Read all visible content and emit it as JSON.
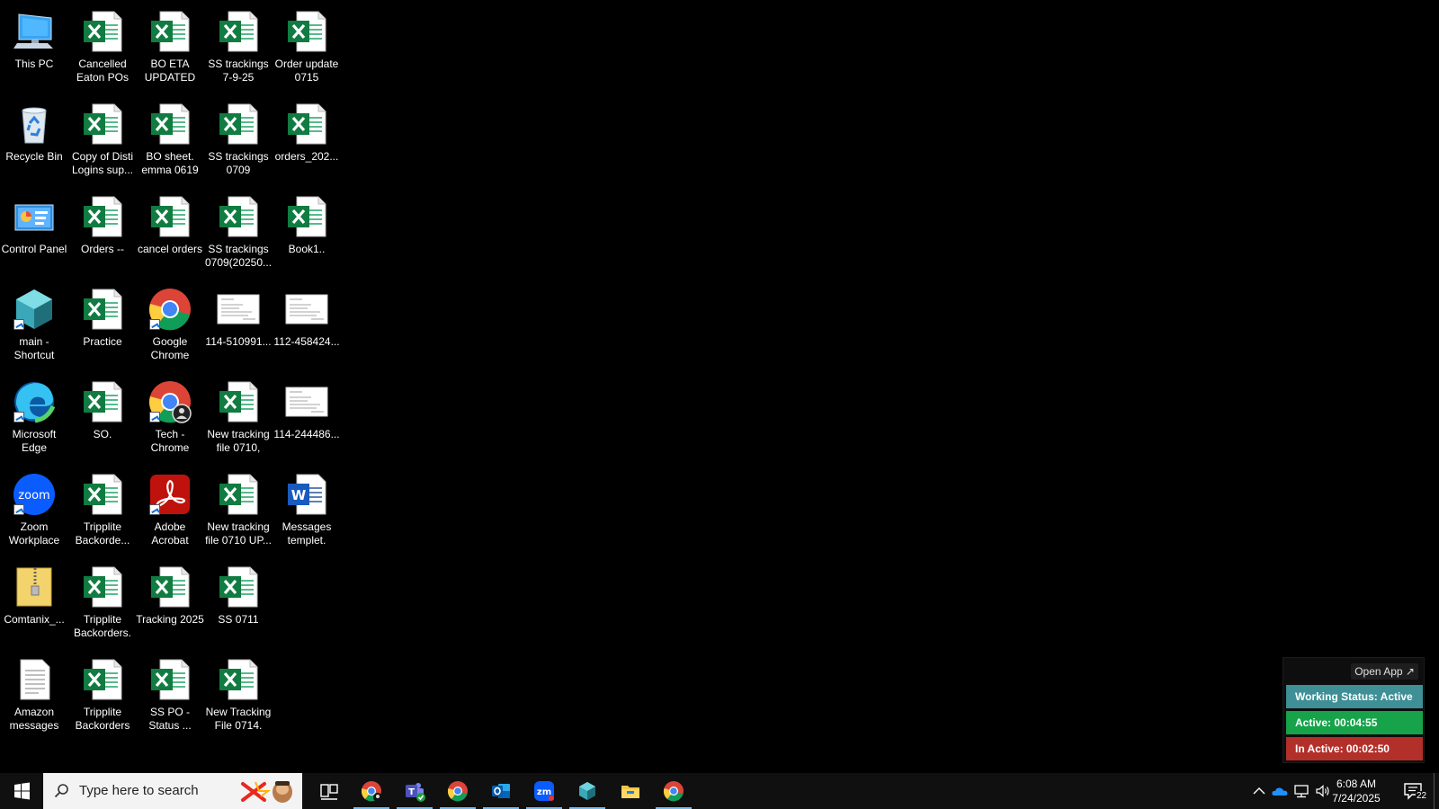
{
  "desktop": {
    "icons": [
      {
        "label": "This PC",
        "type": "pc"
      },
      {
        "label": "Recycle Bin",
        "type": "bin"
      },
      {
        "label": "Control Panel",
        "type": "cpanel"
      },
      {
        "label": "main - Shortcut",
        "type": "main"
      },
      {
        "label": "Microsoft Edge",
        "type": "edge"
      },
      {
        "label": "Zoom Workplace",
        "type": "zoom"
      },
      {
        "label": "Comtanix_...",
        "type": "zip"
      },
      {
        "label": "Amazon messages",
        "type": "txt"
      },
      {
        "label": "Cancelled Eaton POs",
        "type": "excel"
      },
      {
        "label": "Copy of Disti Logins sup...",
        "type": "excel"
      },
      {
        "label": "Orders --",
        "type": "excel"
      },
      {
        "label": "Practice",
        "type": "excel"
      },
      {
        "label": "SO.",
        "type": "excel"
      },
      {
        "label": "Tripplite Backorde...",
        "type": "excel"
      },
      {
        "label": "Tripplite Backorders.",
        "type": "excel"
      },
      {
        "label": "Tripplite Backorders",
        "type": "excel"
      },
      {
        "label": "BO ETA UPDATED",
        "type": "excel"
      },
      {
        "label": "BO sheet. emma 0619",
        "type": "excel"
      },
      {
        "label": "cancel orders",
        "type": "excel"
      },
      {
        "label": "Google Chrome",
        "type": "chrome"
      },
      {
        "label": "Tech - Chrome",
        "type": "chrome-profile"
      },
      {
        "label": "Adobe Acrobat",
        "type": "acrobat"
      },
      {
        "label": "Tracking 2025",
        "type": "excel"
      },
      {
        "label": "SS PO - Status ...",
        "type": "excel"
      },
      {
        "label": "SS trackings 7-9-25",
        "type": "excel"
      },
      {
        "label": "SS trackings 0709",
        "type": "excel"
      },
      {
        "label": "SS trackings 0709(20250...",
        "type": "excel"
      },
      {
        "label": "114-510991...",
        "type": "image"
      },
      {
        "label": "New tracking file 0710,",
        "type": "excel"
      },
      {
        "label": "New tracking file 0710 UP...",
        "type": "excel"
      },
      {
        "label": "SS 0711",
        "type": "excel"
      },
      {
        "label": "New Tracking File 0714.",
        "type": "excel"
      },
      {
        "label": "Order update 0715",
        "type": "excel"
      },
      {
        "label": "orders_202...",
        "type": "excel"
      },
      {
        "label": "Book1..",
        "type": "excel"
      },
      {
        "label": "112-458424...",
        "type": "image"
      },
      {
        "label": "114-244486...",
        "type": "image"
      },
      {
        "label": "Messages templet.",
        "type": "word"
      }
    ]
  },
  "widget": {
    "open_app": "Open App ↗",
    "working_status": "Working Status: Active",
    "active": "Active: 00:04:55",
    "inactive": "In Active: 00:02:50",
    "colors": {
      "status": "#3e8f96",
      "active": "#16a34a",
      "inactive": "#b3302a"
    }
  },
  "taskbar": {
    "search_placeholder": "Type here to search",
    "apps": [
      "chrome-profile-icon",
      "teams-icon",
      "chrome-icon",
      "outlook-icon",
      "zoom-icon",
      "main-app-icon",
      "file-explorer-icon",
      "chrome-icon"
    ],
    "time": "6:08 AM",
    "date": "7/24/2025",
    "notification_count": "22"
  }
}
